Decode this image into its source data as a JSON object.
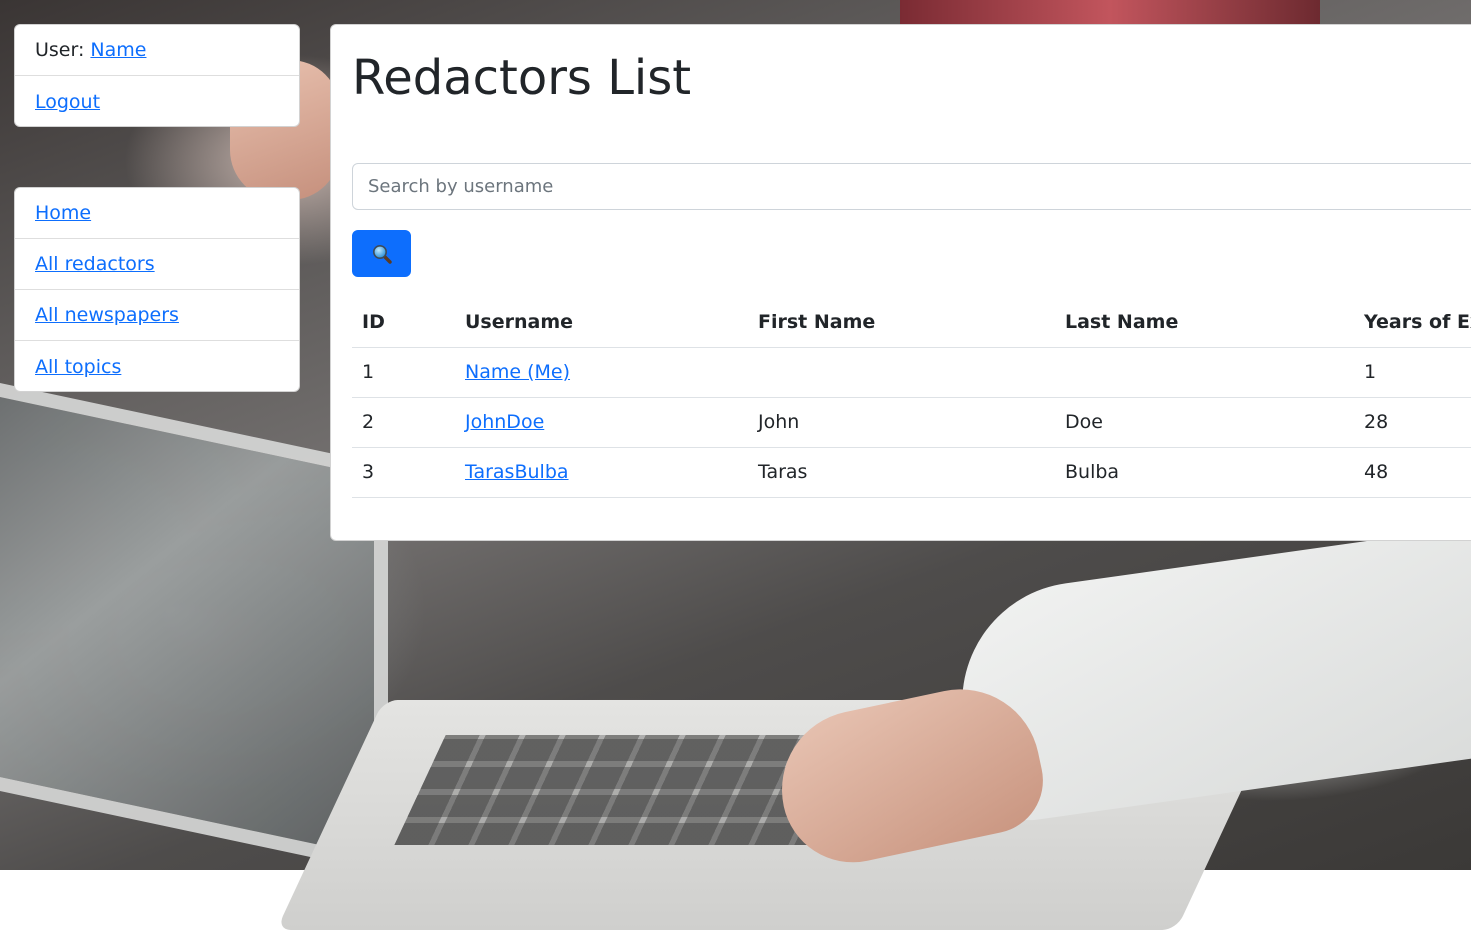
{
  "user_panel": {
    "user_prefix": "User:",
    "user_name": "Name",
    "logout_label": "Logout"
  },
  "nav": {
    "items": [
      {
        "label": "Home"
      },
      {
        "label": "All redactors"
      },
      {
        "label": "All newspapers"
      },
      {
        "label": "All topics"
      }
    ]
  },
  "main": {
    "title": "Redactors List",
    "search": {
      "placeholder": "Search by username",
      "value": "",
      "button_icon": "magnifier-icon"
    },
    "table": {
      "headers": [
        "ID",
        "Username",
        "First Name",
        "Last Name",
        "Years of Exp"
      ],
      "rows": [
        {
          "id": "1",
          "username": "Name (Me)",
          "first_name": "",
          "last_name": "",
          "years": "1"
        },
        {
          "id": "2",
          "username": "JohnDoe",
          "first_name": "John",
          "last_name": "Doe",
          "years": "28"
        },
        {
          "id": "3",
          "username": "TarasBulba",
          "first_name": "Taras",
          "last_name": "Bulba",
          "years": "48"
        }
      ]
    }
  },
  "colors": {
    "link": "#0d6efd",
    "primary_button": "#0d6efd",
    "card_background": "#ffffff",
    "text": "#212529"
  }
}
